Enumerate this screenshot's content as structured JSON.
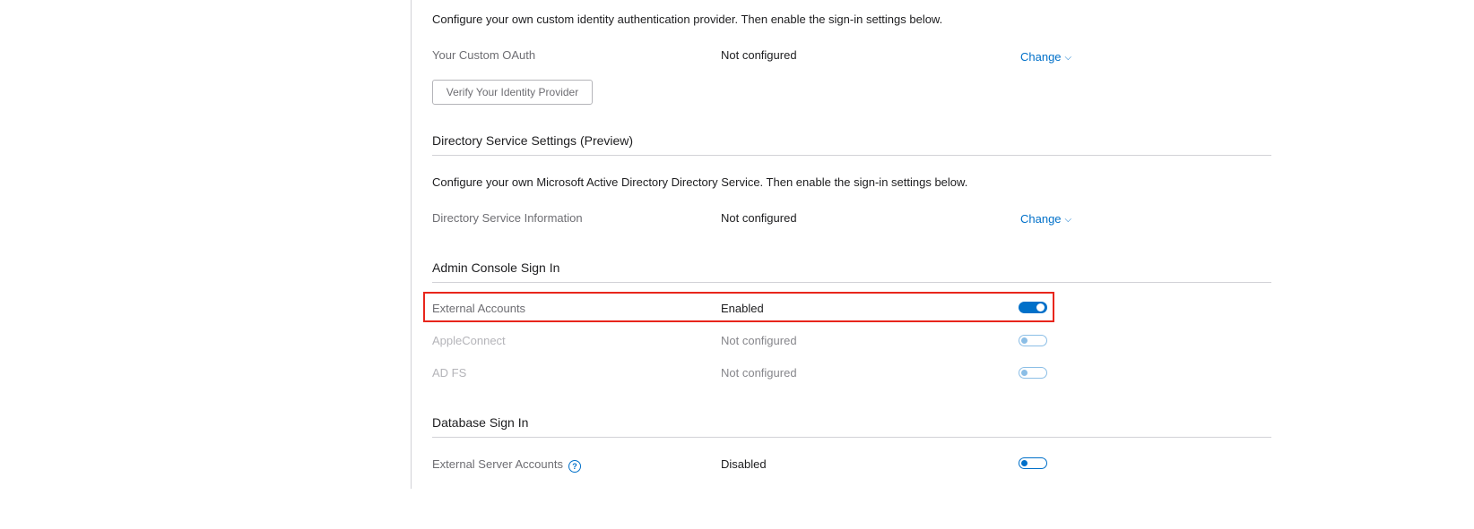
{
  "custom_oauth": {
    "description": "Configure your own custom identity authentication provider. Then enable the sign-in settings below.",
    "label": "Your Custom OAuth",
    "value": "Not configured",
    "change_label": "Change",
    "verify_button": "Verify Your Identity Provider"
  },
  "directory_service": {
    "title": "Directory Service Settings (Preview)",
    "description": "Configure your own Microsoft Active Directory Directory Service. Then enable the sign-in settings below.",
    "label": "Directory Service Information",
    "value": "Not configured",
    "change_label": "Change"
  },
  "admin_console_sign_in": {
    "title": "Admin Console Sign In",
    "rows": [
      {
        "label": "External Accounts",
        "value": "Enabled",
        "toggle": "on",
        "disabled": false
      },
      {
        "label": "AppleConnect",
        "value": "Not configured",
        "toggle": "off",
        "disabled": true
      },
      {
        "label": "AD FS",
        "value": "Not configured",
        "toggle": "off",
        "disabled": true
      }
    ]
  },
  "database_sign_in": {
    "title": "Database Sign In",
    "rows": [
      {
        "label": "External Server Accounts",
        "value": "Disabled",
        "toggle": "off",
        "disabled": false,
        "help_icon": "?"
      }
    ]
  },
  "colors": {
    "accent": "#0070c9",
    "highlight": "#e8261c"
  },
  "icons": {
    "chevron": "chevron-down-icon",
    "help": "help-circle-icon"
  }
}
